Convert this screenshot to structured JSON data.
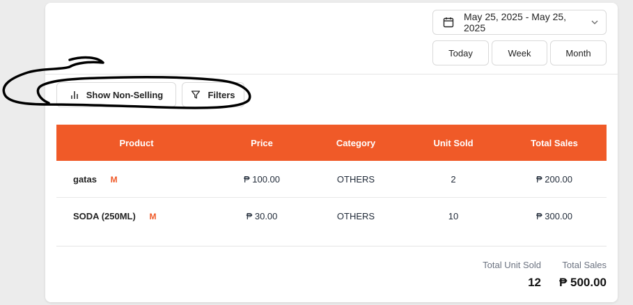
{
  "date_range": {
    "value": "May 25, 2025 - May 25, 2025"
  },
  "range_buttons": {
    "today": "Today",
    "week": "Week",
    "month": "Month"
  },
  "toolbar": {
    "show_non_selling": "Show Non-Selling",
    "filters": "Filters"
  },
  "table": {
    "headers": [
      "Product",
      "Price",
      "Category",
      "Unit Sold",
      "Total Sales"
    ],
    "rows": [
      {
        "product": "gatas",
        "badge": "M",
        "price": "₱ 100.00",
        "category": "OTHERS",
        "units": "2",
        "total": "₱ 200.00"
      },
      {
        "product": "SODA (250ML)",
        "badge": "M",
        "price": "₱ 30.00",
        "category": "OTHERS",
        "units": "10",
        "total": "₱ 300.00"
      }
    ]
  },
  "totals": {
    "unit_sold_label": "Total Unit Sold",
    "unit_sold_value": "12",
    "sales_label": "Total Sales",
    "sales_value": "₱ 500.00"
  },
  "colors": {
    "accent": "#f05a28",
    "annotation": "#000000"
  },
  "icons": [
    "calendar-icon",
    "chevron-down-icon",
    "bar-chart-icon",
    "filter-icon"
  ]
}
